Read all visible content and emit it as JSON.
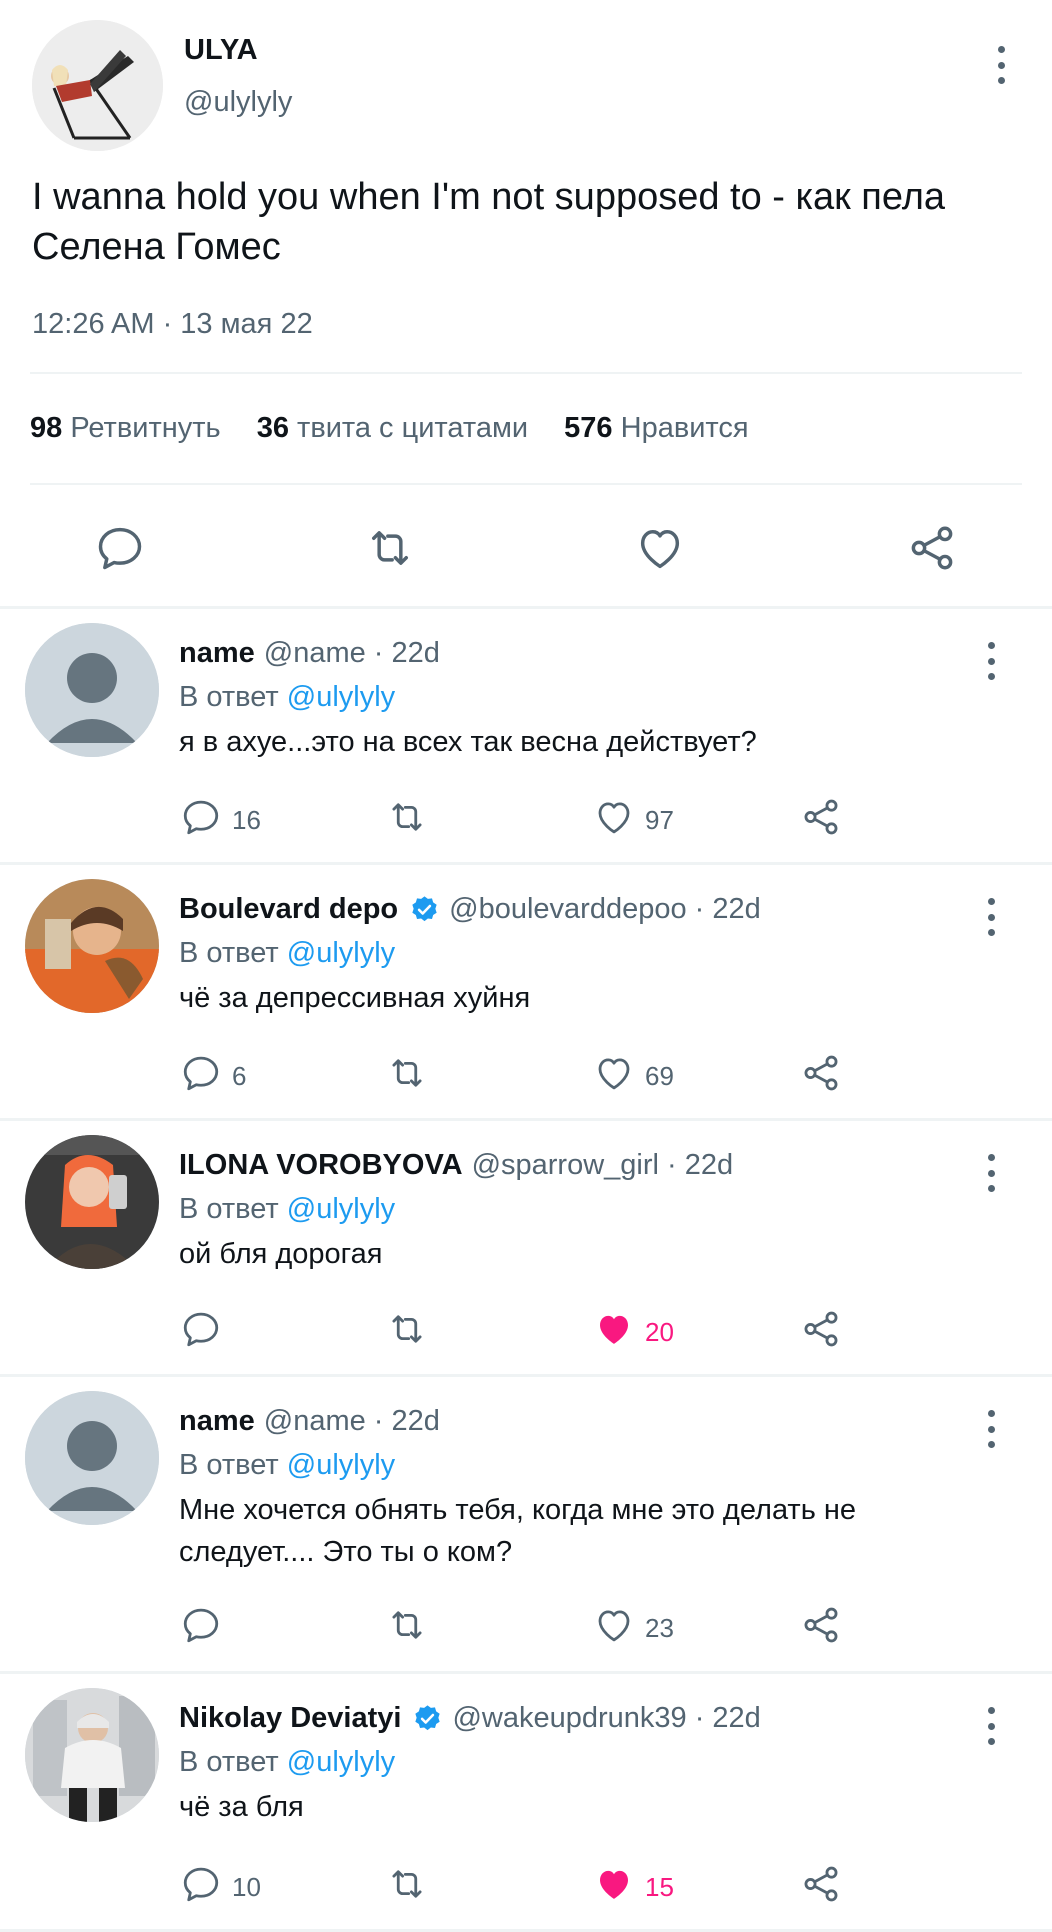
{
  "tweet": {
    "author_name": "ULYA",
    "author_handle": "@ulylyly",
    "text": "I wanna hold you when I'm not supposed to - как пела Селена Гомес",
    "timestamp": "12:26 AM · 13 мая 22",
    "stats": [
      {
        "count": "98",
        "label": "Ретвитнуть"
      },
      {
        "count": "36",
        "label": "твита с цитатами"
      },
      {
        "count": "576",
        "label": "Нравится"
      }
    ]
  },
  "replies": [
    {
      "name": "name",
      "handle_time": "@name · 22d",
      "verified": false,
      "reply_prefix": "В ответ",
      "reply_to": "@ulylyly",
      "text": "я в ахуе...это на всех так весна действует?",
      "comments": "16",
      "likes": "97",
      "liked": false
    },
    {
      "name": "Boulevard depo",
      "handle_time": "@boulevarddepoo · 22d",
      "verified": true,
      "reply_prefix": "В ответ",
      "reply_to": "@ulylyly",
      "text": "чё за депрессивная хуйня",
      "comments": "6",
      "likes": "69",
      "liked": false
    },
    {
      "name": "ILONA VOROBYOVA",
      "handle_time": "@sparrow_girl · 22d",
      "verified": false,
      "reply_prefix": "В ответ",
      "reply_to": "@ulylyly",
      "text": "ой бля дорогая",
      "comments": "",
      "likes": "20",
      "liked": true
    },
    {
      "name": "name",
      "handle_time": "@name · 22d",
      "verified": false,
      "reply_prefix": "В ответ",
      "reply_to": "@ulylyly",
      "text": "Мне хочется обнять тебя, когда мне это делать не следует.... Это ты о ком?",
      "comments": "",
      "likes": "23",
      "liked": false
    },
    {
      "name": "Nikolay Deviatyi",
      "handle_time": "@wakeupdrunk39 · 22d",
      "verified": true,
      "reply_prefix": "В ответ",
      "reply_to": "@ulylyly",
      "text": "чё за бля",
      "comments": "10",
      "likes": "15",
      "liked": true
    }
  ],
  "colors": {
    "accent": "#1d9bf0",
    "like": "#f91880",
    "muted": "#536471",
    "text": "#0f1419"
  }
}
